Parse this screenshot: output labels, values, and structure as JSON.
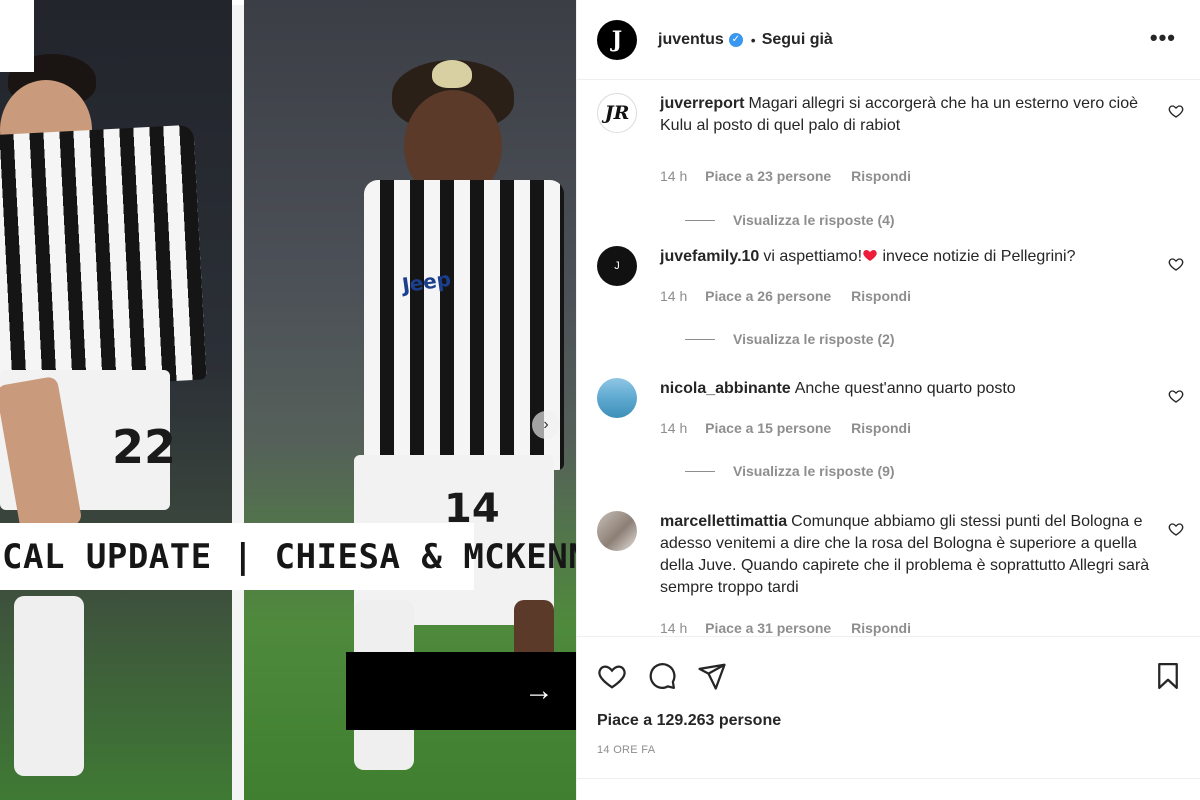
{
  "post": {
    "banner_text": "CAL UPDATE | CHIESA & MCKENNIE",
    "next_arrow": "→",
    "left_player_number": "22",
    "right_player_number": "14",
    "sponsor_text": "Jeep"
  },
  "header": {
    "username": "juventus",
    "separator": "•",
    "follow_label": "Segui già",
    "more_label": "•••"
  },
  "comments": [
    {
      "username": "juverreport",
      "avatar_text": "JR",
      "text": "Magari allegri si accorgerà che ha un esterno vero cioè Kulu al posto di quel palo di rabiot",
      "time": "14 h",
      "likes": "Piace a 23 persone",
      "reply": "Rispondi",
      "view_replies": "Visualizza le risposte (4)"
    },
    {
      "username": "juvefamily.10",
      "avatar_text": "",
      "text_before": "vi aspettiamo!",
      "text_after": " invece notizie di Pellegrini?",
      "time": "14 h",
      "likes": "Piace a 26 persone",
      "reply": "Rispondi",
      "view_replies": "Visualizza le risposte (2)"
    },
    {
      "username": "nicola_abbinante",
      "text": "Anche quest'anno quarto posto",
      "time": "14 h",
      "likes": "Piace a 15 persone",
      "reply": "Rispondi",
      "view_replies": "Visualizza le risposte (9)"
    },
    {
      "username": "marcellettimattia",
      "text": "Comunque abbiamo gli stessi punti del Bologna e adesso venitemi a dire che la rosa del Bologna è superiore a quella della Juve. Quando capirete che il problema è soprattutto Allegri sarà sempre troppo tardi",
      "time": "14 h",
      "likes": "Piace a 31 persone",
      "reply": "Rispondi"
    }
  ],
  "actions": {
    "likes_text": "Piace a 129.263 persone",
    "time_ago": "14 ORE FA"
  },
  "colors": {
    "text": "#262626",
    "secondary": "#8e8e8e",
    "verified": "#3897f0",
    "heart_red": "#ed1c3a"
  },
  "icons": [
    "like-icon",
    "comment-icon",
    "share-icon",
    "bookmark-icon",
    "verified-icon",
    "more-icon"
  ]
}
